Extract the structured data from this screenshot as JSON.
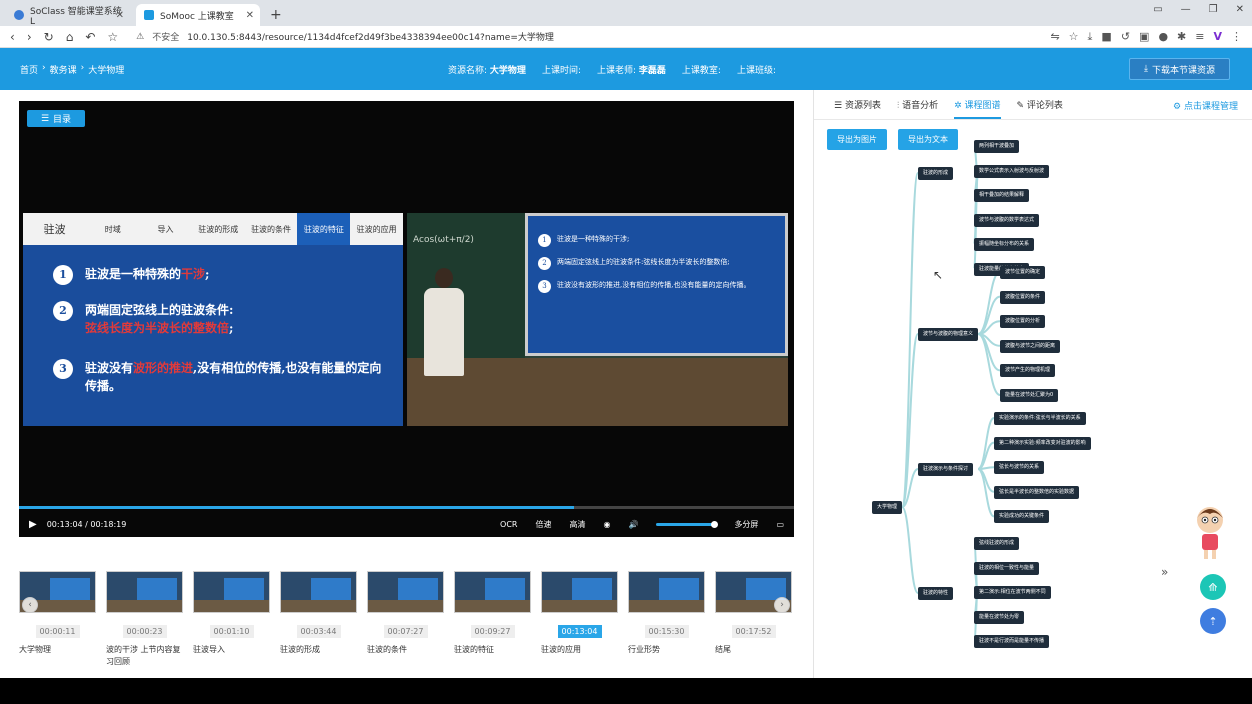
{
  "browser": {
    "tabs": [
      {
        "title": "SoClass 智能课堂系统 L",
        "active": false
      },
      {
        "title": "SoMooc 上课教室",
        "active": true
      }
    ],
    "url_warning": "不安全",
    "url": "10.0.130.5:8443/resource/1134d4fcef2d49f3be4338394ee00c14?name=大学物理"
  },
  "header": {
    "breadcrumb": [
      "首页",
      "教务课",
      "大学物理"
    ],
    "resource_name_label": "资源名称:",
    "resource_name": "大学物理",
    "class_time_label": "上课时间:",
    "teacher_label": "上课老师:",
    "teacher": "李磊磊",
    "classroom_label": "上课教室:",
    "class_label": "上课班级:",
    "download_button": "下载本节课资源"
  },
  "player": {
    "toc_button": "目录",
    "slide": {
      "nav": [
        "驻波",
        "时域",
        "导入",
        "驻波的形成",
        "驻波的条件",
        "驻波的特征",
        "驻波的应用"
      ],
      "active_index": 5,
      "points": [
        {
          "n": "1",
          "text": "驻波是一种特殊的",
          "hl": "干涉",
          "rest": ";"
        },
        {
          "n": "2",
          "text": "两端固定弦线上的驻波条件:",
          "hl": "弦线长度为半波长的整数倍",
          "rest": ";"
        },
        {
          "n": "3",
          "text": "驻波没有",
          "hl": "波形的推进",
          "rest": ",没有相位的传播,也没有能量的定向传播。"
        }
      ]
    },
    "camera_screen_points": [
      {
        "n": "1",
        "text": "驻波是一种特殊的干涉;"
      },
      {
        "n": "2",
        "text": "两端固定弦线上的驻波条件:弦线长度为半波长的整数倍;"
      },
      {
        "n": "3",
        "text": "驻波没有波形的推进,没有相位的传播,也没有能量的定向传播。"
      }
    ],
    "board_text": "Acos(ωt+π/2)",
    "progress": 0.716,
    "time": "00:13:04 / 00:18:19",
    "controls": [
      "OCR",
      "倍速",
      "高清",
      "多分屏"
    ]
  },
  "chapters": [
    {
      "time": "00:00:11",
      "label": "大学物理",
      "active": false
    },
    {
      "time": "00:00:23",
      "label": "波的干涉 上节内容复习回顾",
      "active": false
    },
    {
      "time": "00:01:10",
      "label": "驻波导入",
      "active": false
    },
    {
      "time": "00:03:44",
      "label": "驻波的形成",
      "active": false
    },
    {
      "time": "00:07:27",
      "label": "驻波的条件",
      "active": false
    },
    {
      "time": "00:09:27",
      "label": "驻波的特征",
      "active": false
    },
    {
      "time": "00:13:04",
      "label": "驻波的应用",
      "active": true
    },
    {
      "time": "00:15:30",
      "label": "行业形势",
      "active": false
    },
    {
      "time": "00:17:52",
      "label": "结尾",
      "active": false
    }
  ],
  "panel": {
    "tabs": [
      "资源列表",
      "语音分析",
      "课程图谱",
      "评论列表"
    ],
    "active_tab": 2,
    "manage_link": "点击课程管理",
    "export_image": "导出为图片",
    "export_text": "导出为文本",
    "mindmap": {
      "root": "大学物理",
      "branches": [
        {
          "label": "驻波的形成",
          "children": [
            "两列相干波叠加",
            "数学公式表示入射波与反射波",
            "相干叠加的结果解释",
            "波节与波腹的数学表达式",
            "振幅随坐标分布的关系",
            "驻波能量的分布特点"
          ]
        },
        {
          "label": "波节与波腹的物理意义",
          "children": [
            "波节位置的确定",
            "波腹位置的条件",
            "波腹位置的分析",
            "波腹与波节之间的距离",
            "波节产生的物理机理",
            "能量在波节处汇聚为0"
          ]
        },
        {
          "label": "驻波演示与条件探讨",
          "children": [
            "实验演示的条件:弦长与半波长的关系",
            "第二种演示实验:频率改变对驻波的影响",
            "弦长与波节的关系",
            "弦长是半波长的整数倍的实验数据",
            "实验成功的关键条件"
          ]
        },
        {
          "label": "驻波的特性",
          "children": [
            "弦线驻波的形成",
            "驻波的相位一致性与能量",
            "第二演示:相位在波节两侧不同",
            "能量在波节处为零",
            "驻波不是行波而是能量不传播"
          ]
        }
      ]
    }
  }
}
